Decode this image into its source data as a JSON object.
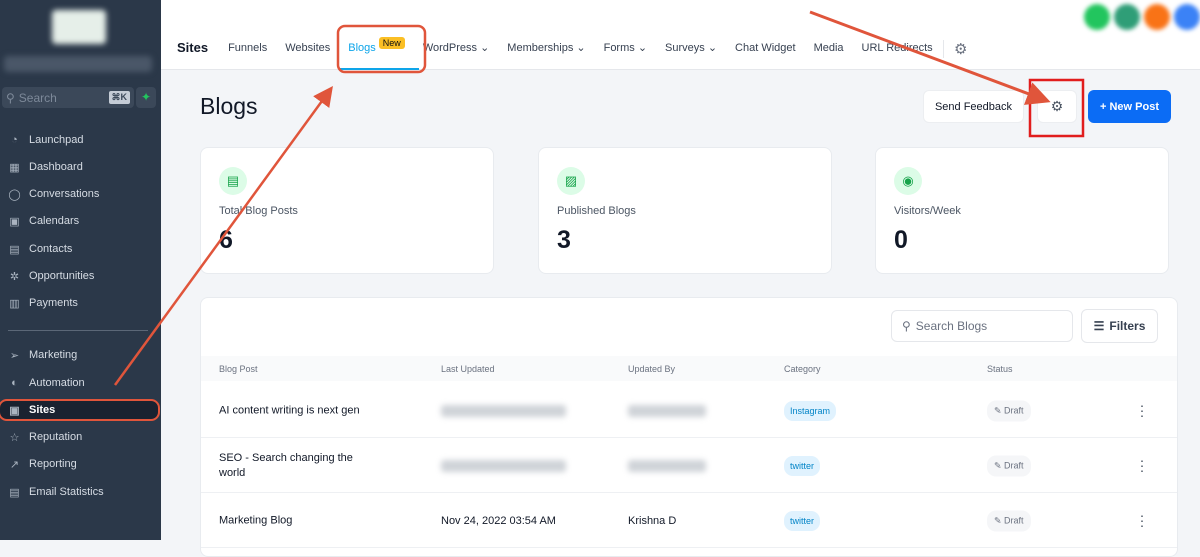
{
  "sidebar": {
    "search_placeholder": "Search",
    "shortcut": "⌘K",
    "items": [
      {
        "label": "Launchpad",
        "icon": "◔"
      },
      {
        "label": "Dashboard",
        "icon": "▦"
      },
      {
        "label": "Conversations",
        "icon": "◯"
      },
      {
        "label": "Calendars",
        "icon": "▣"
      },
      {
        "label": "Contacts",
        "icon": "▤"
      },
      {
        "label": "Opportunities",
        "icon": "✲"
      },
      {
        "label": "Payments",
        "icon": "▥"
      },
      {
        "label": "Marketing",
        "icon": "➢"
      },
      {
        "label": "Automation",
        "icon": "◐"
      },
      {
        "label": "Sites",
        "icon": "▣"
      },
      {
        "label": "Reputation",
        "icon": "☆"
      },
      {
        "label": "Reporting",
        "icon": "↗"
      },
      {
        "label": "Email Statistics",
        "icon": "▤"
      }
    ]
  },
  "topnav": {
    "brand": "Sites",
    "tabs": [
      "Funnels",
      "Websites",
      "Blogs",
      "WordPress ⌄",
      "Memberships ⌄",
      "Forms ⌄",
      "Surveys ⌄",
      "Chat Widget",
      "Media",
      "URL Redirects"
    ],
    "new_badge": "New"
  },
  "page": {
    "title": "Blogs",
    "send_feedback": "Send Feedback",
    "new_post": "+ New Post"
  },
  "stats": [
    {
      "label": "Total Blog Posts",
      "value": "6",
      "icon": "▤"
    },
    {
      "label": "Published Blogs",
      "value": "3",
      "icon": "▨"
    },
    {
      "label": "Visitors/Week",
      "value": "0",
      "icon": "◉"
    }
  ],
  "table": {
    "search_placeholder": "Search Blogs",
    "filters": "Filters",
    "headers": [
      "Blog Post",
      "Last Updated",
      "Updated By",
      "Category",
      "Status"
    ],
    "rows": [
      {
        "title": "AI content writing is next gen",
        "updated": "",
        "by": "",
        "category": "Instagram",
        "status": "Draft"
      },
      {
        "title": "SEO - Search changing the world",
        "updated": "",
        "by": "",
        "category": "twitter",
        "status": "Draft"
      },
      {
        "title": "Marketing Blog",
        "updated": "Nov 24, 2022 03:54 AM",
        "by": "Krishna D",
        "category": "twitter",
        "status": "Draft"
      }
    ]
  },
  "colors": {
    "accent": "#0ea5e9",
    "primary_button": "#0b6cf5",
    "annotation": "#e0553b"
  }
}
